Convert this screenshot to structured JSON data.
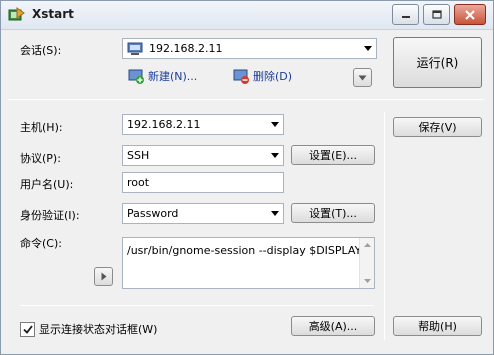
{
  "window": {
    "title": "Xstart"
  },
  "session": {
    "label": "会话(S):",
    "value": "192.168.2.11",
    "new_label": "新建(N)...",
    "delete_label": "删除(D)"
  },
  "run_button": "运行(R)",
  "host": {
    "label": "主机(H):",
    "value": "192.168.2.11"
  },
  "protocol": {
    "label": "协议(P):",
    "value": "SSH",
    "settings_label": "设置(E)..."
  },
  "username": {
    "label": "用户名(U):",
    "value": "root"
  },
  "auth": {
    "label": "身份验证(I):",
    "value": "Password",
    "settings_label": "设置(T)..."
  },
  "command": {
    "label": "命令(C):",
    "value": "/usr/bin/gnome-session --display $DISPLAY"
  },
  "save_button": "保存(V)",
  "show_status": {
    "label": "显示连接状态对话框(W)",
    "checked": true
  },
  "advanced_button": "高级(A)...",
  "help_button": "帮助(H)"
}
